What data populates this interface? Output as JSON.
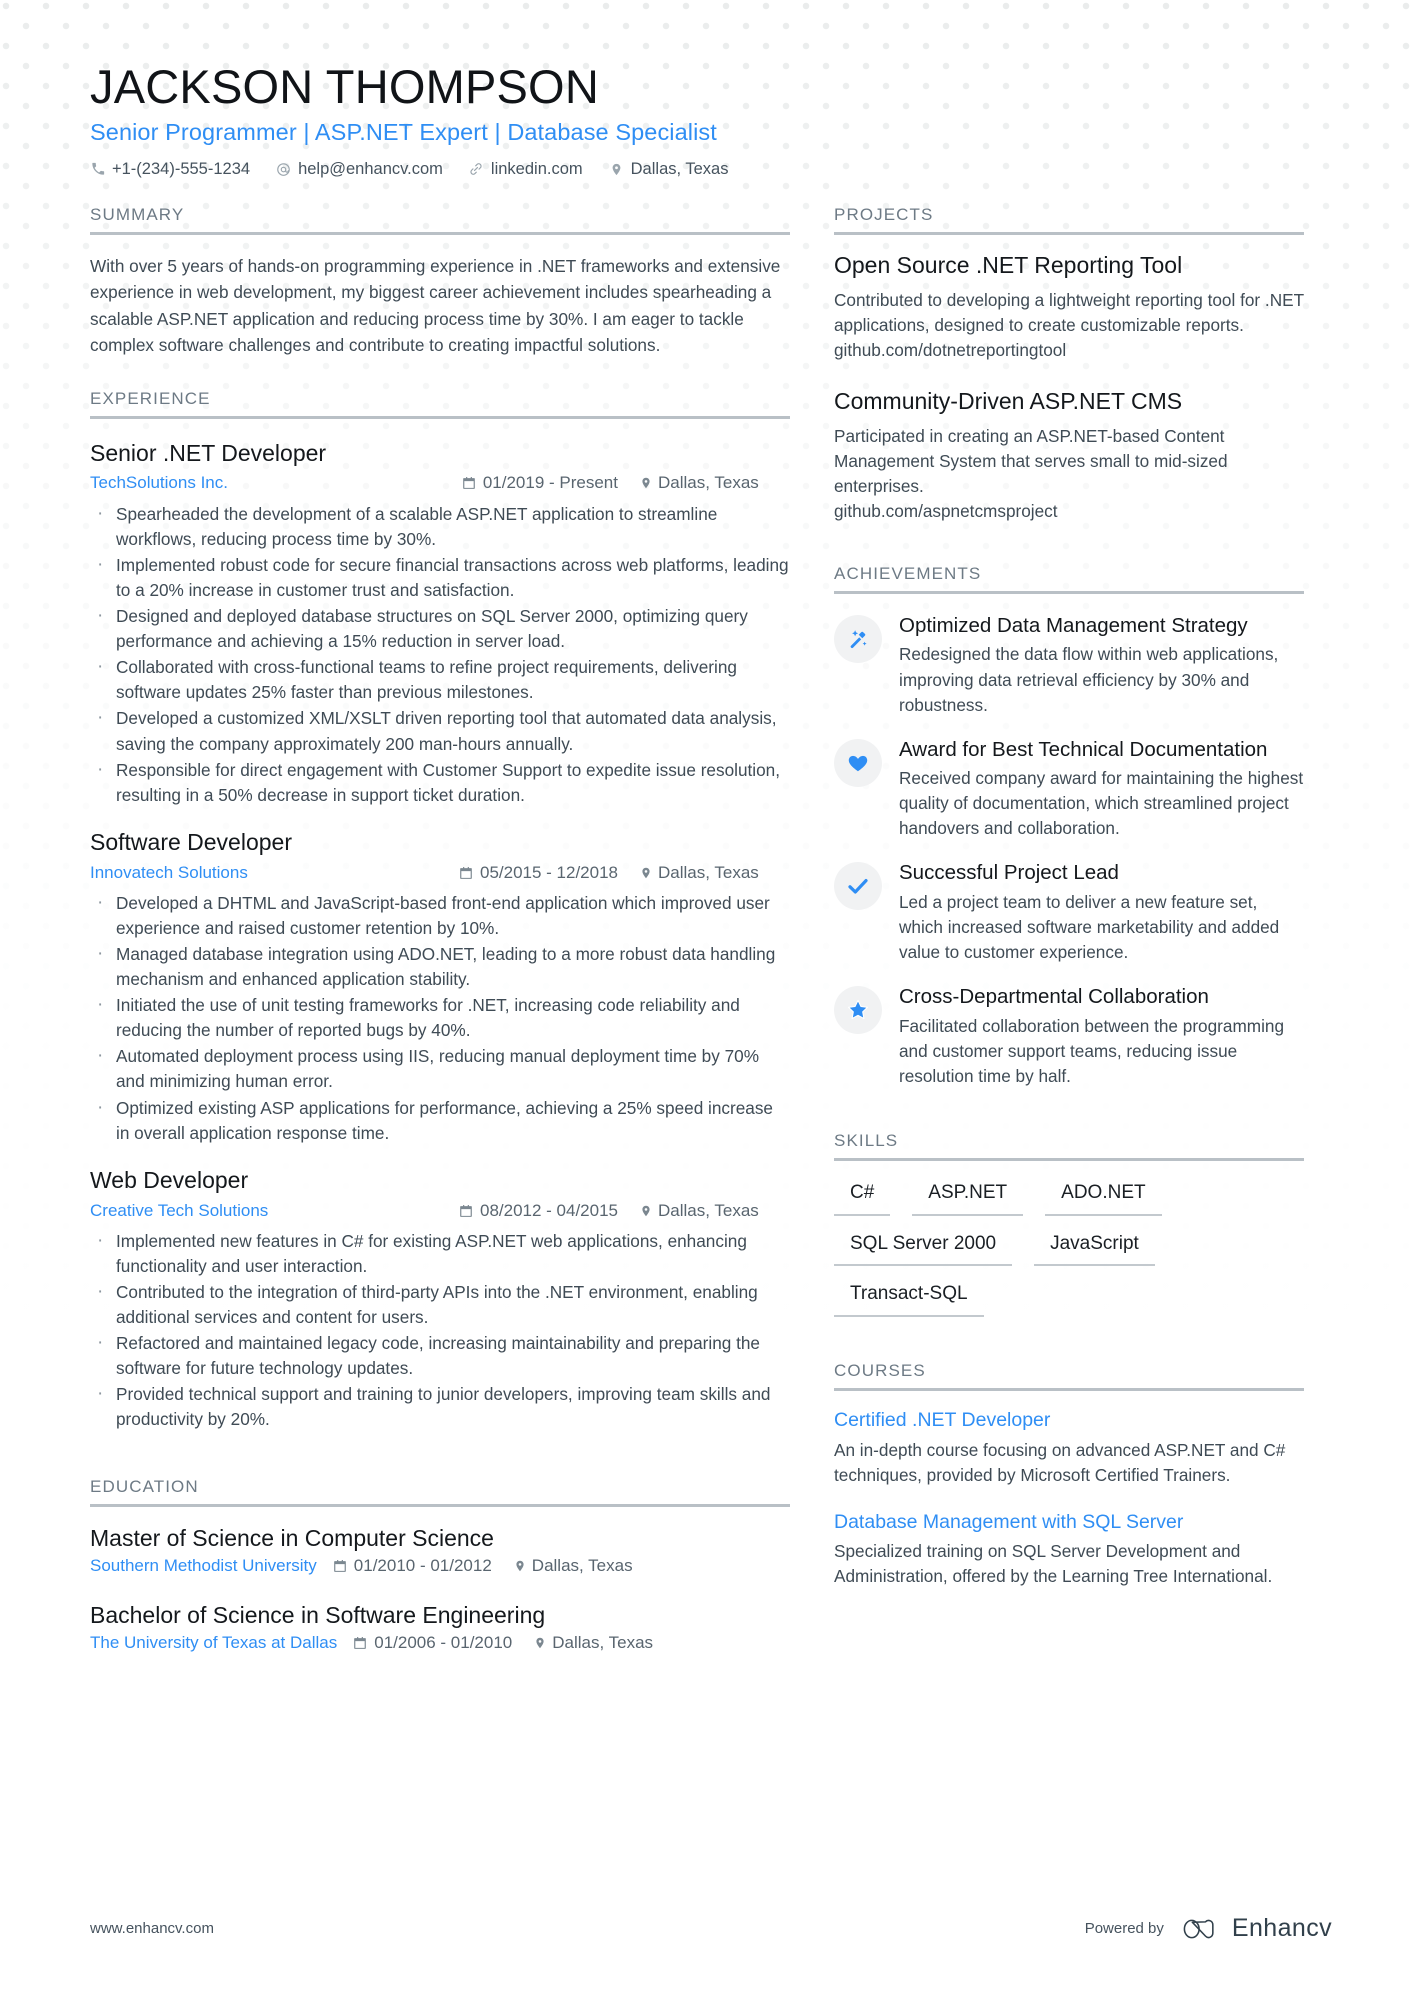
{
  "header": {
    "name": "JACKSON THOMPSON",
    "headline": "Senior Programmer | ASP.NET Expert | Database Specialist",
    "contacts": [
      {
        "icon": "phone-icon",
        "text": "+1-(234)-555-1234"
      },
      {
        "icon": "email-icon",
        "text": "help@enhancv.com"
      },
      {
        "icon": "link-icon",
        "text": "linkedin.com"
      },
      {
        "icon": "location-icon",
        "text": "Dallas, Texas"
      }
    ]
  },
  "summary": {
    "title": "SUMMARY",
    "text": "With over 5 years of hands-on programming experience in .NET frameworks and extensive experience in web development, my biggest career achievement includes spearheading a scalable ASP.NET application and reducing process time by 30%. I am eager to tackle complex software challenges and contribute to creating impactful solutions."
  },
  "experience": {
    "title": "EXPERIENCE",
    "jobs": [
      {
        "title": "Senior .NET Developer",
        "company": "TechSolutions Inc.",
        "dates": "01/2019 - Present",
        "location": "Dallas, Texas",
        "bullets": [
          "Spearheaded the development of a scalable ASP.NET application to streamline workflows, reducing process time by 30%.",
          "Implemented robust code for secure financial transactions across web platforms, leading to a 20% increase in customer trust and satisfaction.",
          "Designed and deployed database structures on SQL Server 2000, optimizing query performance and achieving a 15% reduction in server load.",
          "Collaborated with cross-functional teams to refine project requirements, delivering software updates 25% faster than previous milestones.",
          "Developed a customized XML/XSLT driven reporting tool that automated data analysis, saving the company approximately 200 man-hours annually.",
          "Responsible for direct engagement with Customer Support to expedite issue resolution, resulting in a 50% decrease in support ticket duration."
        ]
      },
      {
        "title": "Software Developer",
        "company": "Innovatech Solutions",
        "dates": "05/2015 - 12/2018",
        "location": "Dallas, Texas",
        "bullets": [
          "Developed a DHTML and JavaScript-based front-end application which improved user experience and raised customer retention by 10%.",
          "Managed database integration using ADO.NET, leading to a more robust data handling mechanism and enhanced application stability.",
          "Initiated the use of unit testing frameworks for .NET, increasing code reliability and reducing the number of reported bugs by 40%.",
          "Automated deployment process using IIS, reducing manual deployment time by 70% and minimizing human error.",
          "Optimized existing ASP applications for performance, achieving a 25% speed increase in overall application response time."
        ]
      },
      {
        "title": "Web Developer",
        "company": "Creative Tech Solutions",
        "dates": "08/2012 - 04/2015",
        "location": "Dallas, Texas",
        "bullets": [
          "Implemented new features in C# for existing ASP.NET web applications, enhancing functionality and user interaction.",
          "Contributed to the integration of third-party APIs into the .NET environment, enabling additional services and content for users.",
          "Refactored and maintained legacy code, increasing maintainability and preparing the software for future technology updates.",
          "Provided technical support and training to junior developers, improving team skills and productivity by 20%."
        ]
      }
    ]
  },
  "education": {
    "title": "EDUCATION",
    "entries": [
      {
        "degree": "Master of Science in Computer Science",
        "school": "Southern Methodist University",
        "dates": "01/2010 - 01/2012",
        "location": "Dallas, Texas"
      },
      {
        "degree": "Bachelor of Science in Software Engineering",
        "school": "The University of Texas at Dallas",
        "dates": "01/2006 - 01/2010",
        "location": "Dallas, Texas"
      }
    ]
  },
  "projects": {
    "title": "PROJECTS",
    "items": [
      {
        "title": "Open Source .NET Reporting Tool",
        "description": "Contributed to developing a lightweight reporting tool for .NET applications, designed to create customizable reports.",
        "link": "github.com/dotnetreportingtool"
      },
      {
        "title": "Community-Driven ASP.NET CMS",
        "description": "Participated in creating an ASP.NET-based Content Management System that serves small to mid-sized enterprises.",
        "link": "github.com/aspnetcmsproject"
      }
    ]
  },
  "achievements": {
    "title": "ACHIEVEMENTS",
    "items": [
      {
        "icon": "magic-wand-icon",
        "title": "Optimized Data Management Strategy",
        "description": "Redesigned the data flow within web applications, improving data retrieval efficiency by 30% and robustness."
      },
      {
        "icon": "heart-icon",
        "title": "Award for Best Technical Documentation",
        "description": "Received company award for maintaining the highest quality of documentation, which streamlined project handovers and collaboration."
      },
      {
        "icon": "check-icon",
        "title": "Successful Project Lead",
        "description": "Led a project team to deliver a new feature set, which increased software marketability and added value to customer experience."
      },
      {
        "icon": "star-icon",
        "title": "Cross-Departmental Collaboration",
        "description": "Facilitated collaboration between the programming and customer support teams, reducing issue resolution time by half."
      }
    ]
  },
  "skills": {
    "title": "SKILLS",
    "items": [
      "C#",
      "ASP.NET",
      "ADO.NET",
      "SQL Server 2000",
      "JavaScript",
      "Transact-SQL"
    ]
  },
  "courses": {
    "title": "COURSES",
    "items": [
      {
        "title": "Certified .NET Developer",
        "description": "An in-depth course focusing on advanced ASP.NET and C# techniques, provided by Microsoft Certified Trainers."
      },
      {
        "title": "Database Management with SQL Server",
        "description": "Specialized training on SQL Server Development and Administration, offered by the Learning Tree International."
      }
    ]
  },
  "footer": {
    "url": "www.enhancv.com",
    "powered_by": "Powered by",
    "brand": "Enhancv"
  },
  "colors": {
    "accent": "#2f8ef4",
    "text": "#3f4b55",
    "heading": "#14181c",
    "muted": "#6d7a85",
    "rule": "#b9c0c6",
    "icon_bg": "#f1f2f3"
  }
}
